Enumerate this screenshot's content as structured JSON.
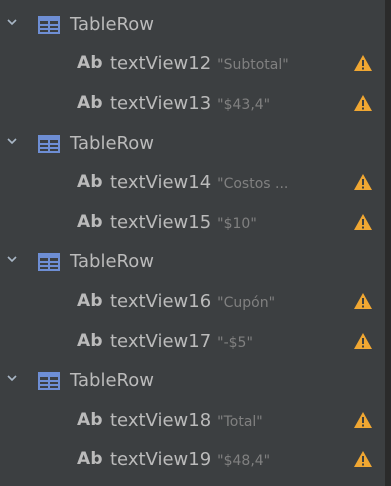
{
  "tree": {
    "groups": [
      {
        "label": "TableRow",
        "children": [
          {
            "icon": "Ab",
            "id": "textView12",
            "value": "\"Subtotal\""
          },
          {
            "icon": "Ab",
            "id": "textView13",
            "value": "\"$43,4\""
          }
        ]
      },
      {
        "label": "TableRow",
        "children": [
          {
            "icon": "Ab",
            "id": "textView14",
            "value": "\"Costos ..."
          },
          {
            "icon": "Ab",
            "id": "textView15",
            "value": "\"$10\""
          }
        ]
      },
      {
        "label": "TableRow",
        "children": [
          {
            "icon": "Ab",
            "id": "textView16",
            "value": "\"Cupón\""
          },
          {
            "icon": "Ab",
            "id": "textView17",
            "value": "\"-$5\""
          }
        ]
      },
      {
        "label": "TableRow",
        "children": [
          {
            "icon": "Ab",
            "id": "textView18",
            "value": "\"Total\""
          },
          {
            "icon": "Ab",
            "id": "textView19",
            "value": "\"$48,4\""
          }
        ]
      }
    ]
  },
  "colors": {
    "background": "#3c3f41",
    "text": "#bbbbbb",
    "value_text": "#808080",
    "table_icon": "#6e8ed4",
    "warning": "#f0a732"
  },
  "icons": {
    "expand": "chevron-down-icon",
    "row": "table-row-icon",
    "text": "text-view-icon",
    "warning": "warning-icon"
  }
}
